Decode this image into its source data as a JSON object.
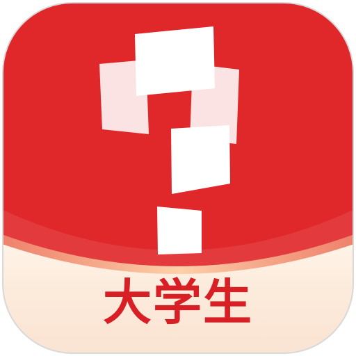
{
  "app_icon": {
    "label": "大学生",
    "logo": "question-mark-cards-logo",
    "colors": {
      "brand_red": "#E0282B",
      "label_text": "#D81F25",
      "label_band": "#FCEBDC",
      "card_white": "#FFFFFF",
      "card_pink": "#FBE3E3",
      "frame_border": "#D8D8D8"
    }
  }
}
